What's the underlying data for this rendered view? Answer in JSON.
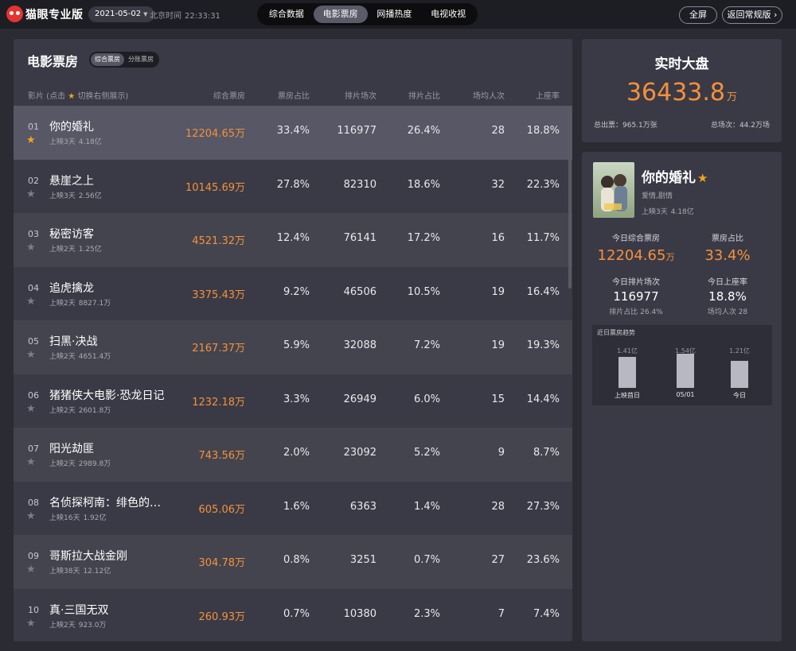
{
  "topbar": {
    "brand": "猫眼专业版",
    "date": "2021-05-02",
    "clock_label": "北京时间",
    "clock_time": "22:33:31",
    "tabs": [
      {
        "label": "综合数据",
        "active": false
      },
      {
        "label": "电影票房",
        "active": true
      },
      {
        "label": "网播热度",
        "active": false
      },
      {
        "label": "电视收视",
        "active": false
      }
    ],
    "fullscreen_label": "全屏",
    "back_label": "返回常规版"
  },
  "boxoffice": {
    "title": "电影票房",
    "subtabs": [
      "综合票房",
      "分账票房"
    ],
    "headers": {
      "film_prefix": "影片 (点击",
      "film_suffix": "切换右侧展示)",
      "box": "综合票房",
      "share": "票房占比",
      "shows": "排片场次",
      "show_share": "排片占比",
      "avg": "场均人次",
      "seat": "上座率"
    },
    "rows": [
      {
        "rank": "01",
        "title": "你的婚礼",
        "days": "上映3天",
        "total": "4.18亿",
        "box": "12204.65万",
        "share": "33.4%",
        "shows": "116977",
        "show_share": "26.4%",
        "avg": "28",
        "seat": "18.8%"
      },
      {
        "rank": "02",
        "title": "悬崖之上",
        "days": "上映3天",
        "total": "2.56亿",
        "box": "10145.69万",
        "share": "27.8%",
        "shows": "82310",
        "show_share": "18.6%",
        "avg": "32",
        "seat": "22.3%"
      },
      {
        "rank": "03",
        "title": "秘密访客",
        "days": "上映2天",
        "total": "1.25亿",
        "box": "4521.32万",
        "share": "12.4%",
        "shows": "76141",
        "show_share": "17.2%",
        "avg": "16",
        "seat": "11.7%"
      },
      {
        "rank": "04",
        "title": "追虎擒龙",
        "days": "上映2天",
        "total": "8827.1万",
        "box": "3375.43万",
        "share": "9.2%",
        "shows": "46506",
        "show_share": "10.5%",
        "avg": "19",
        "seat": "16.4%"
      },
      {
        "rank": "05",
        "title": "扫黑·决战",
        "days": "上映2天",
        "total": "4651.4万",
        "box": "2167.37万",
        "share": "5.9%",
        "shows": "32088",
        "show_share": "7.2%",
        "avg": "19",
        "seat": "19.3%"
      },
      {
        "rank": "06",
        "title": "猪猪侠大电影·恐龙日记",
        "days": "上映2天",
        "total": "2601.8万",
        "box": "1232.18万",
        "share": "3.3%",
        "shows": "26949",
        "show_share": "6.0%",
        "avg": "15",
        "seat": "14.4%"
      },
      {
        "rank": "07",
        "title": "阳光劫匪",
        "days": "上映2天",
        "total": "2989.8万",
        "box": "743.56万",
        "share": "2.0%",
        "shows": "23092",
        "show_share": "5.2%",
        "avg": "9",
        "seat": "8.7%"
      },
      {
        "rank": "08",
        "title": "名侦探柯南：绯色的…",
        "days": "上映16天",
        "total": "1.92亿",
        "box": "605.06万",
        "share": "1.6%",
        "shows": "6363",
        "show_share": "1.4%",
        "avg": "28",
        "seat": "27.3%"
      },
      {
        "rank": "09",
        "title": "哥斯拉大战金刚",
        "days": "上映38天",
        "total": "12.12亿",
        "box": "304.78万",
        "share": "0.8%",
        "shows": "3251",
        "show_share": "0.7%",
        "avg": "27",
        "seat": "23.6%"
      },
      {
        "rank": "10",
        "title": "真·三国无双",
        "days": "上映2天",
        "total": "923.0万",
        "box": "260.93万",
        "share": "0.7%",
        "shows": "10380",
        "show_share": "2.3%",
        "avg": "7",
        "seat": "7.4%"
      }
    ]
  },
  "realtime": {
    "title": "实时大盘",
    "value": "36433.8",
    "unit": "万",
    "tickets": "总出票：965.1万张",
    "shows": "总场次：44.2万场"
  },
  "detail": {
    "title": "你的婚礼",
    "genre": "爱情,剧情",
    "days": "上映3天",
    "total": "4.18亿",
    "stats": {
      "box_label": "今日综合票房",
      "box_value": "12204.65",
      "box_unit": "万",
      "share_label": "票房占比",
      "share_value": "33.4%",
      "shows_label": "今日排片场次",
      "shows_value": "116977",
      "shows_sub": "排片占比 26.4%",
      "seat_label": "今日上座率",
      "seat_value": "18.8%",
      "seat_sub": "场均人次 28"
    },
    "trend": {
      "title": "近日票房趋势",
      "bars": [
        {
          "label": "上映首日",
          "value_label": "1.41亿",
          "value": 1.41
        },
        {
          "label": "05/01",
          "value_label": "1.54亿",
          "value": 1.54
        },
        {
          "label": "今日",
          "value_label": "1.21亿",
          "value": 1.21
        }
      ]
    }
  },
  "colors": {
    "accent_orange": "#f5913a",
    "star_gold": "#f0a51a",
    "brand_red": "#e5342f",
    "background": "#2b2b34",
    "panel": "#3a3a46"
  },
  "icons": {
    "logo": "cat-eye-logo",
    "star": "star-icon",
    "dropdown": "chevron-down-icon",
    "back": "chevron-right-icon"
  }
}
